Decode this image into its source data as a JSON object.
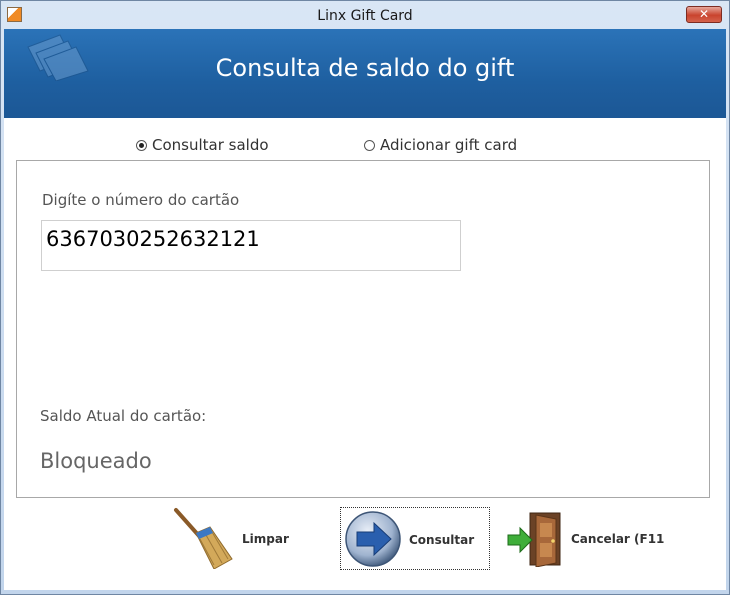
{
  "window": {
    "title": "Linx Gift Card",
    "close_label": "✕"
  },
  "header": {
    "title": "Consulta de saldo do gift"
  },
  "mode": {
    "options": [
      {
        "label": "Consultar saldo",
        "selected": true
      },
      {
        "label": "Adicionar gift card",
        "selected": false
      }
    ]
  },
  "form": {
    "card_label": "Digíte o número do cartão",
    "card_value": "6367030252632121",
    "balance_label": "Saldo Atual do cartão:",
    "balance_value": "Bloqueado"
  },
  "buttons": {
    "clear": "Limpar",
    "query": "Consultar",
    "cancel": "Cancelar (F11"
  },
  "icons": [
    "app-icon",
    "close-icon",
    "cards-icon",
    "broom-icon",
    "arrow-right-icon",
    "exit-door-icon"
  ]
}
